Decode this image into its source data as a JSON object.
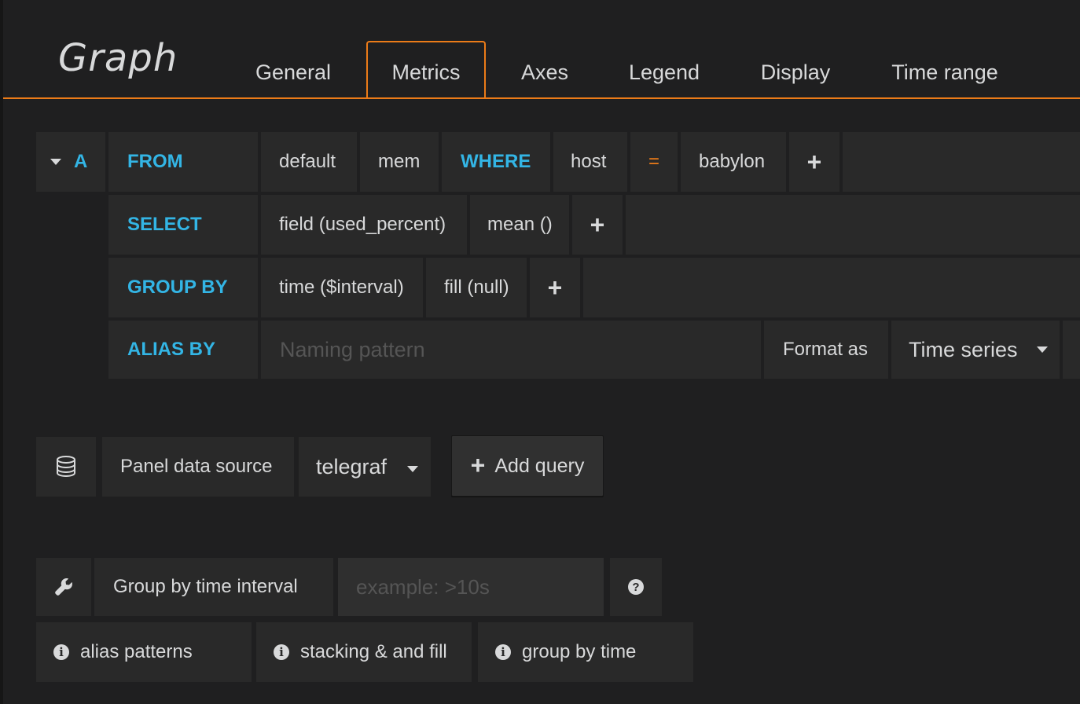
{
  "panel": {
    "title": "Graph"
  },
  "tabs": [
    {
      "label": "General"
    },
    {
      "label": "Metrics"
    },
    {
      "label": "Axes"
    },
    {
      "label": "Legend"
    },
    {
      "label": "Display"
    },
    {
      "label": "Time range"
    }
  ],
  "active_tab": "Metrics",
  "query": {
    "ref_id": "A",
    "from": {
      "keyword": "FROM",
      "policy": "default",
      "measurement": "mem"
    },
    "where": {
      "keyword": "WHERE",
      "key": "host",
      "operator": "=",
      "value": "babylon"
    },
    "select": {
      "keyword": "SELECT",
      "field": "field (used_percent)",
      "func": "mean ()"
    },
    "group_by": {
      "keyword": "GROUP BY",
      "time": "time ($interval)",
      "fill": "fill (null)"
    },
    "alias_by": {
      "keyword": "ALIAS BY",
      "placeholder": "Naming pattern"
    },
    "format_as": {
      "label": "Format as",
      "value": "Time series"
    },
    "add_symbol": "+"
  },
  "datasource": {
    "label": "Panel data source",
    "value": "telegraf",
    "add_query": "Add query",
    "add_query_symbol": "+"
  },
  "options": {
    "group_interval_label": "Group by time interval",
    "group_interval_placeholder": "example: >10s",
    "help_symbol": "?"
  },
  "help_links": [
    {
      "label": "alias patterns"
    },
    {
      "label": "stacking & and fill"
    },
    {
      "label": "group by time"
    }
  ],
  "info_symbol": "i",
  "colors": {
    "accent": "#eb7b18",
    "keyword": "#33b5e5",
    "segment_bg": "#292929",
    "panel_bg": "#1f1f20"
  }
}
